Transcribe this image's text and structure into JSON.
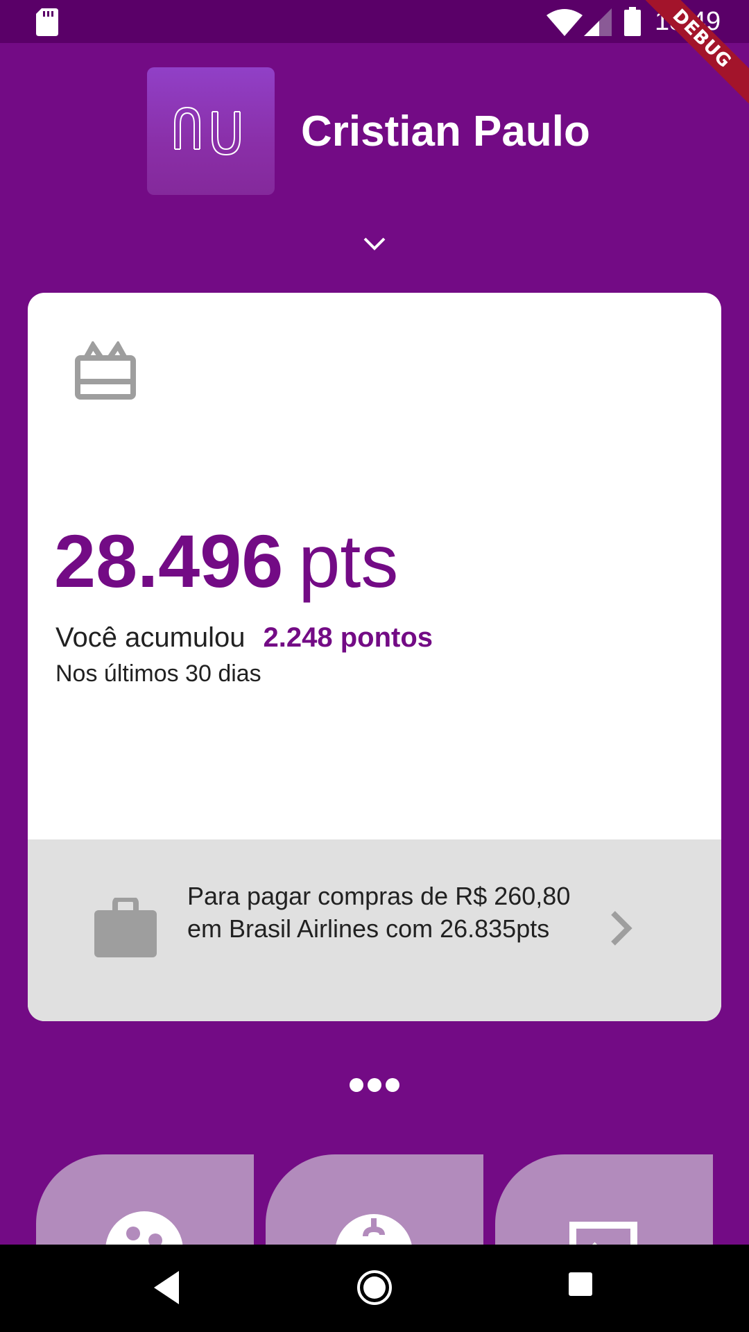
{
  "status_bar": {
    "time": "18:49",
    "debug_label": "DEBUG",
    "icons": [
      "sd-card-icon",
      "wifi-icon",
      "signal-icon",
      "battery-icon"
    ]
  },
  "header": {
    "logo_icon": "nu-logo-icon",
    "user_name": "Cristian Paulo",
    "expand_icon": "chevron-down-icon"
  },
  "card": {
    "icon": "gift-card-icon",
    "points_value": "28.496",
    "points_unit": "pts",
    "accumulated_label": "Você acumulou",
    "accumulated_value": "2.248 pontos",
    "period": "Nos últimos 30 dias",
    "footer": {
      "icon": "briefcase-icon",
      "text": "Para pagar compras de R$ 260,80 em Brasil Airlines com 26.835pts",
      "action_icon": "chevron-right-icon"
    }
  },
  "pager": {
    "count": 3
  },
  "shortcuts": [
    {
      "icon": "people-icon"
    },
    {
      "icon": "money-icon"
    },
    {
      "icon": "transfer-icon"
    }
  ],
  "nav_bar": {
    "icons": [
      "back-icon",
      "home-icon",
      "recent-apps-icon"
    ]
  },
  "colors": {
    "brand_purple": "#730b85",
    "status_bar": "#5a0068",
    "card_footer": "#e0e0e0",
    "icon_gray": "#9e9e9e",
    "tile": "#b28bbc",
    "debug_ribbon": "#a3142b"
  }
}
